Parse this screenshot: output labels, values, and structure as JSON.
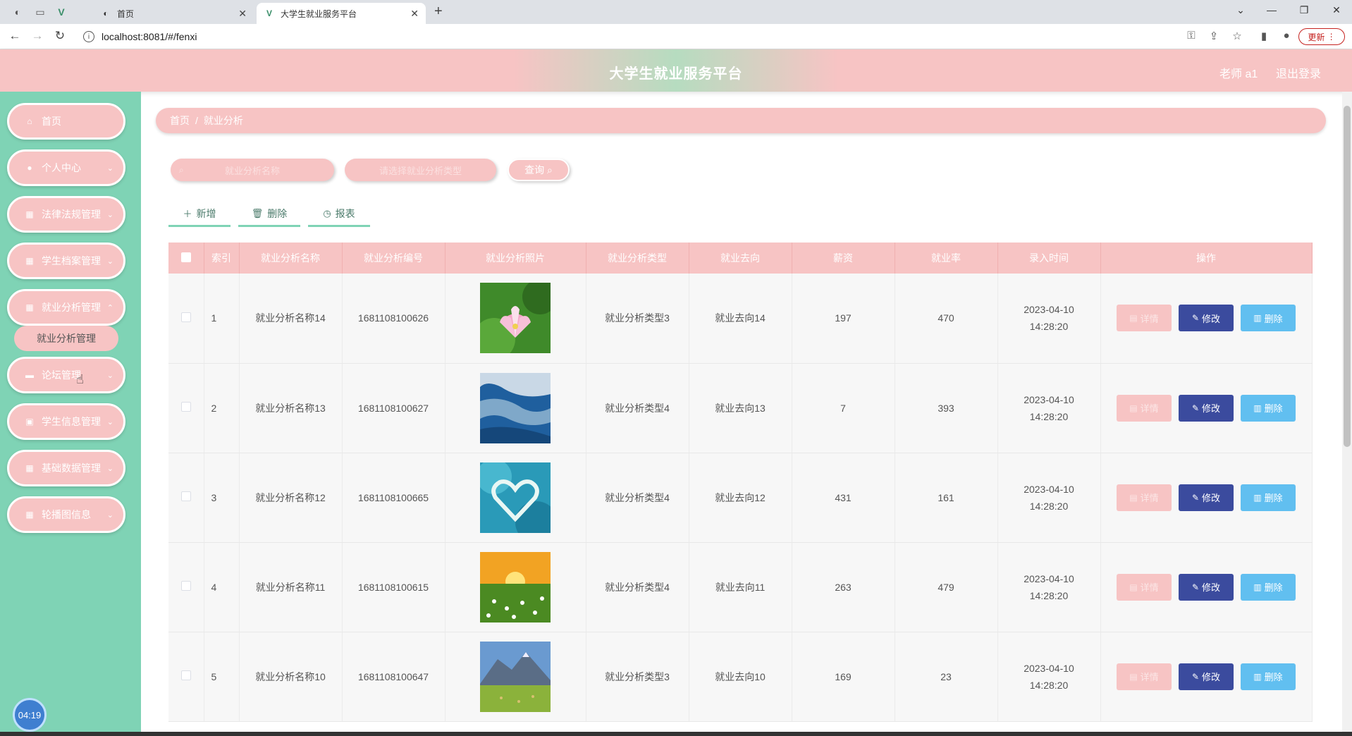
{
  "browser": {
    "tab_inactive_title": "首页",
    "tab_active_title": "大学生就业服务平台",
    "url": "localhost:8081/#/fenxi",
    "update_label": "更新"
  },
  "header": {
    "title": "大学生就业服务平台",
    "user": "老师 a1",
    "logout": "退出登录"
  },
  "sidebar": {
    "items": [
      {
        "label": "首页",
        "icon": "home-icon"
      },
      {
        "label": "个人中心",
        "icon": "user-icon"
      },
      {
        "label": "法律法规管理",
        "icon": "grid-icon"
      },
      {
        "label": "学生档案管理",
        "icon": "grid-icon"
      },
      {
        "label": "就业分析管理",
        "icon": "grid-icon"
      },
      {
        "label": "论坛管理",
        "icon": "monitor-icon"
      },
      {
        "label": "学生信息管理",
        "icon": "briefcase-icon"
      },
      {
        "label": "基础数据管理",
        "icon": "grid-icon"
      },
      {
        "label": "轮播图信息",
        "icon": "grid-icon"
      }
    ],
    "sub_item": "就业分析管理",
    "clock": "04:19"
  },
  "breadcrumb": {
    "home": "首页",
    "separator": "/",
    "current": "就业分析"
  },
  "search": {
    "name_placeholder": "就业分析名称",
    "type_placeholder": "请选择就业分析类型",
    "button": "查询"
  },
  "actions": {
    "add": "新增",
    "delete": "删除",
    "report": "报表"
  },
  "table": {
    "headers": [
      "索引",
      "就业分析名称",
      "就业分析编号",
      "就业分析照片",
      "就业分析类型",
      "就业去向",
      "薪资",
      "就业率",
      "录入时间",
      "操作"
    ],
    "rows": [
      {
        "index": "1",
        "name": "就业分析名称14",
        "code": "1681108100626",
        "type": "就业分析类型3",
        "destination": "就业去向14",
        "salary": "197",
        "rate": "470",
        "time": "2023-04-10 14:28:20",
        "image": "pink-lotus"
      },
      {
        "index": "2",
        "name": "就业分析名称13",
        "code": "1681108100627",
        "type": "就业分析类型4",
        "destination": "就业去向13",
        "salary": "7",
        "rate": "393",
        "time": "2023-04-10 14:28:20",
        "image": "aerial-river"
      },
      {
        "index": "3",
        "name": "就业分析名称12",
        "code": "1681108100665",
        "type": "就业分析类型4",
        "destination": "就业去向12",
        "salary": "431",
        "rate": "161",
        "time": "2023-04-10 14:28:20",
        "image": "heart-island"
      },
      {
        "index": "4",
        "name": "就业分析名称11",
        "code": "1681108100615",
        "type": "就业分析类型4",
        "destination": "就业去向11",
        "salary": "263",
        "rate": "479",
        "time": "2023-04-10 14:28:20",
        "image": "sunset-meadow"
      },
      {
        "index": "5",
        "name": "就业分析名称10",
        "code": "1681108100647",
        "type": "就业分析类型3",
        "destination": "就业去向10",
        "salary": "169",
        "rate": "23",
        "time": "2023-04-10 14:28:20",
        "image": "mountain-field"
      }
    ],
    "op_labels": {
      "detail": "详情",
      "edit": "修改",
      "delete": "删除"
    }
  },
  "colors": {
    "pink": "#f7c4c4",
    "mint": "#7fd3b5",
    "edit": "#3b4b9e",
    "delete": "#61bff0"
  }
}
